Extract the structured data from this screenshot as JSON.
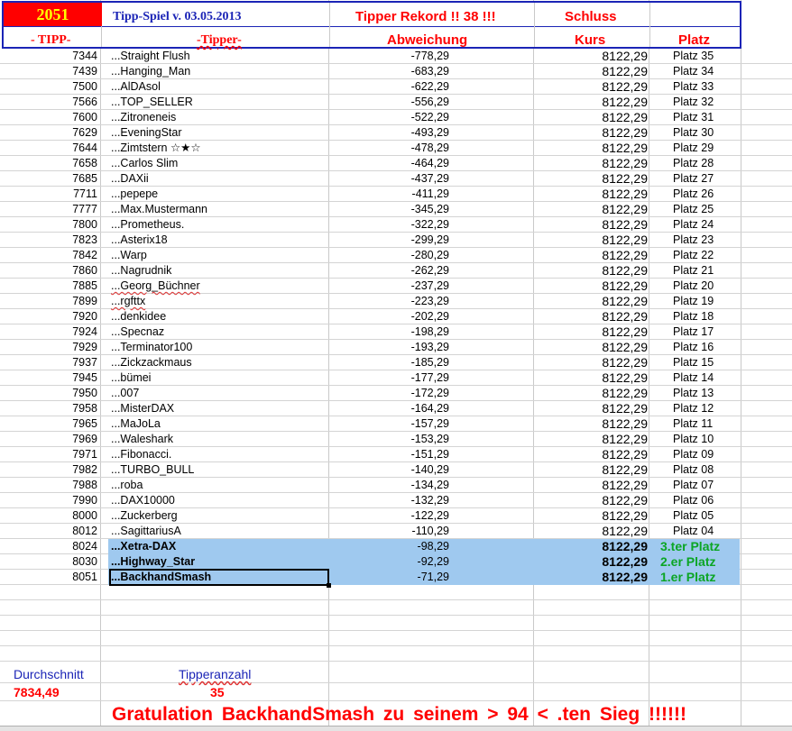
{
  "header": {
    "number": "2051",
    "title": "Tipp-Spiel v. 03.05.2013",
    "rekord": "Tipper Rekord !!  38  !!!",
    "schluss": "Schluss",
    "col_tipp": "- TIPP-",
    "col_tipper": "-Tipper-",
    "col_abweichung": "Abweichung",
    "col_kurs": "Kurs",
    "col_platz": "Platz"
  },
  "rows": [
    {
      "tipp": "7344",
      "name": "...Straight Flush",
      "abw": "-778,29",
      "kurs": "8122,29",
      "platz": "Platz 35"
    },
    {
      "tipp": "7439",
      "name": "...Hanging_Man",
      "abw": "-683,29",
      "kurs": "8122,29",
      "platz": "Platz 34"
    },
    {
      "tipp": "7500",
      "name": "...AlDAsol",
      "abw": "-622,29",
      "kurs": "8122,29",
      "platz": "Platz 33"
    },
    {
      "tipp": "7566",
      "name": "...TOP_SELLER",
      "abw": "-556,29",
      "kurs": "8122,29",
      "platz": "Platz 32"
    },
    {
      "tipp": "7600",
      "name": "...Zitroneneis",
      "abw": "-522,29",
      "kurs": "8122,29",
      "platz": "Platz 31"
    },
    {
      "tipp": "7629",
      "name": "...EveningStar",
      "abw": "-493,29",
      "kurs": "8122,29",
      "platz": "Platz 30"
    },
    {
      "tipp": "7644",
      "name": "...Zimtstern ☆★☆",
      "abw": "-478,29",
      "kurs": "8122,29",
      "platz": "Platz 29"
    },
    {
      "tipp": "7658",
      "name": "...Carlos Slim",
      "abw": "-464,29",
      "kurs": "8122,29",
      "platz": "Platz 28"
    },
    {
      "tipp": "7685",
      "name": "...DAXii",
      "abw": "-437,29",
      "kurs": "8122,29",
      "platz": "Platz 27"
    },
    {
      "tipp": "7711",
      "name": "...pepepe",
      "abw": "-411,29",
      "kurs": "8122,29",
      "platz": "Platz 26"
    },
    {
      "tipp": "7777",
      "name": "...Max.Mustermann",
      "abw": "-345,29",
      "kurs": "8122,29",
      "platz": "Platz 25"
    },
    {
      "tipp": "7800",
      "name": "...Prometheus.",
      "abw": "-322,29",
      "kurs": "8122,29",
      "platz": "Platz 24"
    },
    {
      "tipp": "7823",
      "name": "...Asterix18",
      "abw": "-299,29",
      "kurs": "8122,29",
      "platz": "Platz 23"
    },
    {
      "tipp": "7842",
      "name": "...Warp",
      "abw": "-280,29",
      "kurs": "8122,29",
      "platz": "Platz 22"
    },
    {
      "tipp": "7860",
      "name": "...Nagrudnik",
      "abw": "-262,29",
      "kurs": "8122,29",
      "platz": "Platz 21"
    },
    {
      "tipp": "7885",
      "name": "...Georg_Büchner",
      "abw": "-237,29",
      "kurs": "8122,29",
      "platz": "Platz 20"
    },
    {
      "tipp": "7899",
      "name": "...rgfttx",
      "abw": "-223,29",
      "kurs": "8122,29",
      "platz": "Platz 19"
    },
    {
      "tipp": "7920",
      "name": "...denkidee",
      "abw": "-202,29",
      "kurs": "8122,29",
      "platz": "Platz 18"
    },
    {
      "tipp": "7924",
      "name": "...Specnaz",
      "abw": "-198,29",
      "kurs": "8122,29",
      "platz": "Platz 17"
    },
    {
      "tipp": "7929",
      "name": "...Terminator100",
      "abw": "-193,29",
      "kurs": "8122,29",
      "platz": "Platz 16"
    },
    {
      "tipp": "7937",
      "name": "...Zickzackmaus",
      "abw": "-185,29",
      "kurs": "8122,29",
      "platz": "Platz 15"
    },
    {
      "tipp": "7945",
      "name": "...bümei",
      "abw": "-177,29",
      "kurs": "8122,29",
      "platz": "Platz 14"
    },
    {
      "tipp": "7950",
      "name": "...007",
      "abw": "-172,29",
      "kurs": "8122,29",
      "platz": "Platz 13"
    },
    {
      "tipp": "7958",
      "name": "...MisterDAX",
      "abw": "-164,29",
      "kurs": "8122,29",
      "platz": "Platz 12"
    },
    {
      "tipp": "7965",
      "name": "...MaJoLa",
      "abw": "-157,29",
      "kurs": "8122,29",
      "platz": "Platz 11"
    },
    {
      "tipp": "7969",
      "name": "...Waleshark",
      "abw": "-153,29",
      "kurs": "8122,29",
      "platz": "Platz 10"
    },
    {
      "tipp": "7971",
      "name": "...Fibonacci.",
      "abw": "-151,29",
      "kurs": "8122,29",
      "platz": "Platz 09"
    },
    {
      "tipp": "7982",
      "name": "...TURBO_BULL",
      "abw": "-140,29",
      "kurs": "8122,29",
      "platz": "Platz 08"
    },
    {
      "tipp": "7988",
      "name": "...roba",
      "abw": "-134,29",
      "kurs": "8122,29",
      "platz": "Platz 07"
    },
    {
      "tipp": "7990",
      "name": "...DAX10000",
      "abw": "-132,29",
      "kurs": "8122,29",
      "platz": "Platz 06"
    },
    {
      "tipp": "8000",
      "name": "...Zuckerberg",
      "abw": "-122,29",
      "kurs": "8122,29",
      "platz": "Platz 05"
    },
    {
      "tipp": "8012",
      "name": "...SagittariusA",
      "abw": "-110,29",
      "kurs": "8122,29",
      "platz": "Platz 04"
    },
    {
      "tipp": "8024",
      "name": "...Xetra-DAX",
      "abw": "-98,29",
      "kurs": "8122,29",
      "platz": "3.ter Platz"
    },
    {
      "tipp": "8030",
      "name": "...Highway_Star",
      "abw": "-92,29",
      "kurs": "8122,29",
      "platz": "2.er Platz"
    },
    {
      "tipp": "8051",
      "name": "...BackhandSmash",
      "abw": "-71,29",
      "kurs": "8122,29",
      "platz": "1.er Platz"
    }
  ],
  "footer": {
    "durchschnitt_label": "Durchschnitt",
    "durchschnitt_value": "7834,49",
    "tipperanzahl_label": "Tipperanzahl",
    "tipperanzahl_value": "35",
    "gratulation": "Gratulation   BackhandSmash   zu seinem > 94 < .ten Sieg !!!!!!"
  },
  "colors": {
    "header_border": "#1b24b6",
    "red": "#ff0000",
    "yellow": "#ffff00",
    "highlight": "#9fc9ef",
    "green": "#0ba524"
  }
}
